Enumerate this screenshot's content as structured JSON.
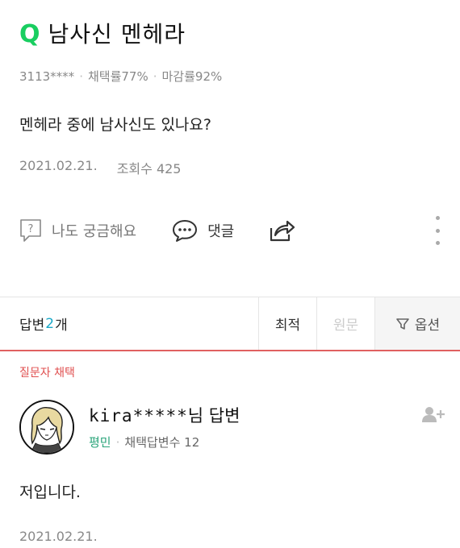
{
  "question": {
    "q_icon": "Q",
    "title": "남사신 멘헤라",
    "asker": "3113****",
    "adopt_rate": "채택률77%",
    "close_rate": "마감률92%",
    "body": "멘헤라 중에 남사신도 있나요?",
    "date": "2021.02.21.",
    "views": "조회수 425"
  },
  "actions": {
    "curious_label": "나도 궁금해요",
    "comment_label": "댓글",
    "icons": [
      "question-box-icon",
      "speech-bubble-icon",
      "share-icon",
      "more-vertical-icon"
    ]
  },
  "answers_bar": {
    "prefix": "답변 ",
    "count": "2",
    "suffix": "개",
    "sort_best": "최적",
    "sort_original": "원문",
    "options": "옵션"
  },
  "answer": {
    "chosen_label": "질문자 채택",
    "username": "kira*****",
    "name_suffix": "님 답변",
    "rank": "평민",
    "adopted_count": "채택답변수 12",
    "body": "저입니다.",
    "date": "2021.02.21."
  },
  "colors": {
    "brand_green": "#19ce60",
    "count_blue": "#19a8c8",
    "chosen_red": "#e05050",
    "rank_green": "#2aa47a"
  }
}
